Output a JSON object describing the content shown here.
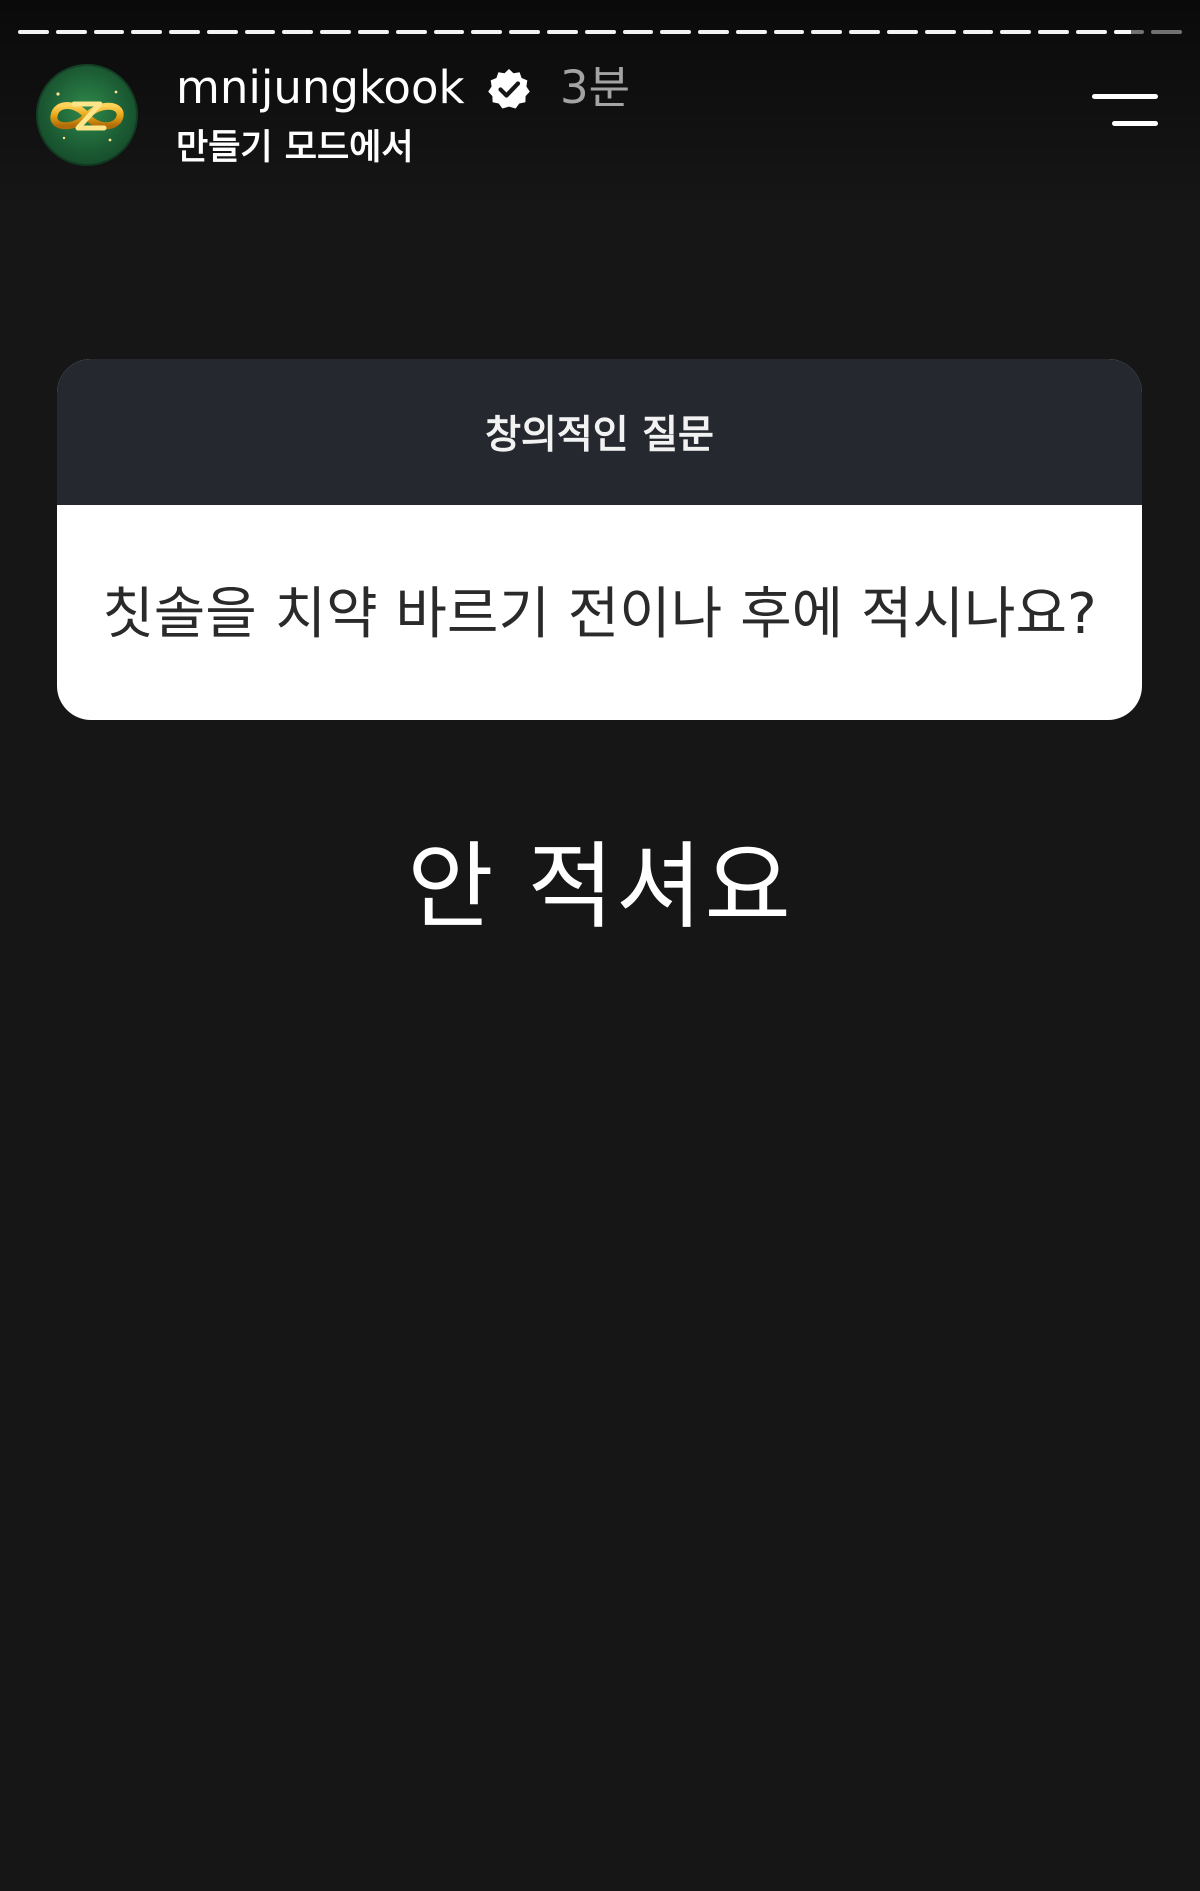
{
  "story": {
    "segment_count": 31,
    "current_segment": 30,
    "current_progress": 0.55
  },
  "header": {
    "username": "mnijungkook",
    "timestamp": "3분",
    "subtitle": "만들기 모드에서",
    "verified_icon": "verified-badge-icon",
    "menu_icon": "menu-icon"
  },
  "question_sticker": {
    "title": "창의적인 질문",
    "question": "칫솔을 치약 바르기 전이나 후에 적시나요?"
  },
  "answer": {
    "text": "안 적셔요"
  },
  "colors": {
    "background": "#161616",
    "sticker_header": "#262830",
    "sticker_body": "#ffffff",
    "avatar_green": "#1b5a33",
    "avatar_gold": "#e8a417"
  }
}
